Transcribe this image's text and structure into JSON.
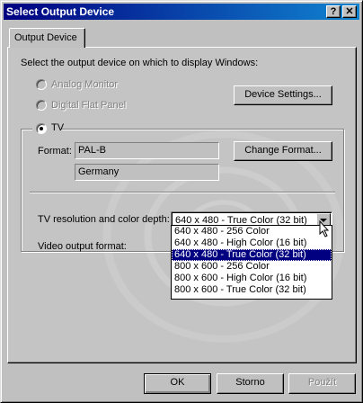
{
  "window": {
    "title": "Select Output Device"
  },
  "titlebar": {
    "help_label": "?",
    "close_label": "✕"
  },
  "tabs": [
    {
      "label": "Output Device"
    }
  ],
  "panel": {
    "instruction": "Select the output device on which to display Windows:",
    "devices": [
      {
        "label": "Analog Monitor",
        "enabled": false,
        "selected": false
      },
      {
        "label": "Digital Flat Panel",
        "enabled": false,
        "selected": false
      },
      {
        "label": "TV",
        "enabled": true,
        "selected": true
      }
    ],
    "device_settings_label": "Device Settings...",
    "format": {
      "label": "Format:",
      "value": "PAL-B",
      "country": "Germany",
      "change_label": "Change Format..."
    },
    "resolution": {
      "label": "TV resolution and color depth:",
      "selected": "640 x 480 - True Color (32 bit)",
      "options": [
        "640 x 480 - 256 Color",
        "640 x 480 - High Color (16 bit)",
        "640 x 480 - True Color (32 bit)",
        "800 x 600 - 256 Color",
        "800 x 600 - High Color (16 bit)",
        "800 x 600 - True Color (32 bit)"
      ],
      "highlighted_index": 2
    },
    "video_output": {
      "label": "Video output format:"
    }
  },
  "buttons": {
    "ok": "OK",
    "cancel": "Storno",
    "apply": "Použít"
  },
  "colors": {
    "title_start": "#000080",
    "title_end": "#1084d0",
    "selection": "#000080",
    "face": "#c0c0c0"
  },
  "icons": {
    "cursor": "arrow-cursor-icon",
    "dropdown": "chevron-down-icon",
    "radio": "radio-icon"
  }
}
